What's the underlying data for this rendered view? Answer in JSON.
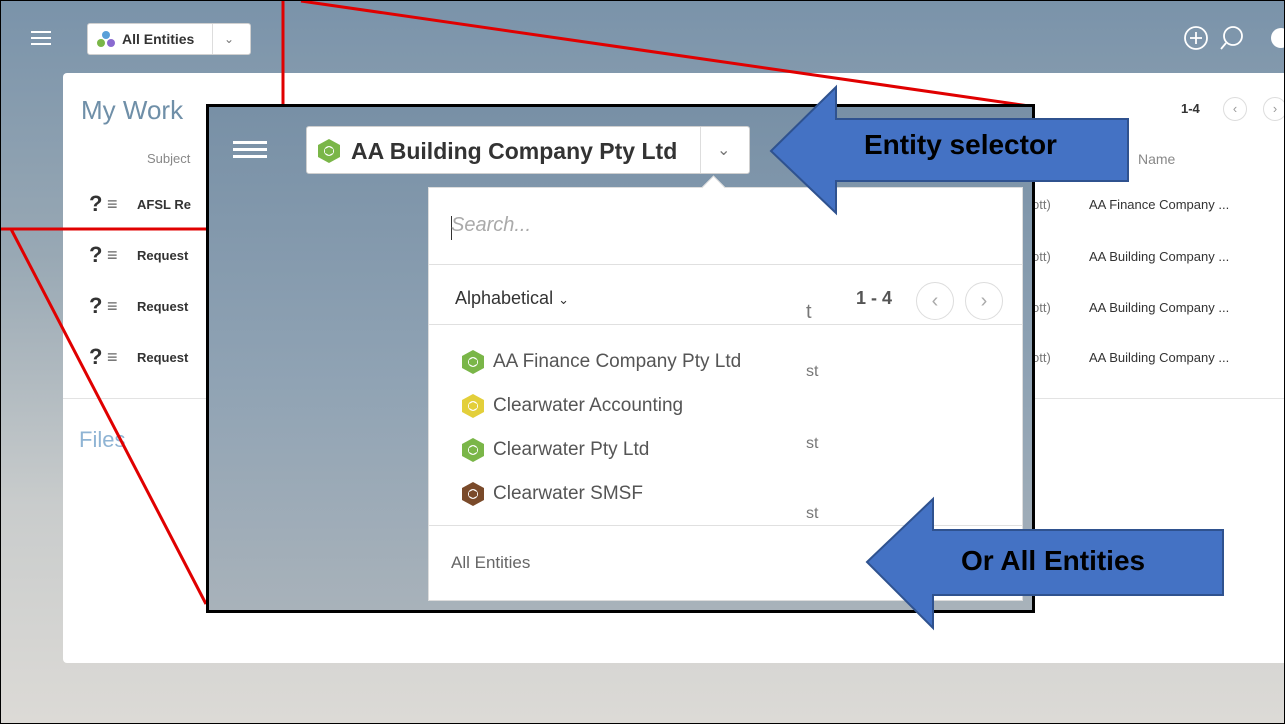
{
  "app": {
    "entity_selector_label": "All Entities",
    "my_work_title": "My Work",
    "subject_header": "Subject",
    "name_header": "Name",
    "pager": "1-4",
    "files_title": "Files",
    "rows": [
      {
        "subject": "AFSL Re",
        "suffix": "ott)",
        "name": "AA Finance Company ..."
      },
      {
        "subject": "Request",
        "suffix": "ott)",
        "name": "AA Building Company ..."
      },
      {
        "subject": "Request",
        "suffix": "ott)",
        "name": "AA Building Company ..."
      },
      {
        "subject": "Request",
        "suffix": "ott)",
        "name": "AA Building Company ..."
      }
    ]
  },
  "zoom": {
    "selected_entity": "AA Building Company Pty Ltd",
    "search_placeholder": "Search...",
    "sort_label": "Alphabetical",
    "pager": "1 - 4",
    "entities": [
      {
        "label": "AA Finance Company Pty Ltd",
        "color": "#7ab648"
      },
      {
        "label": "Clearwater Accounting",
        "color": "#e3cf3a"
      },
      {
        "label": "Clearwater Pty Ltd",
        "color": "#7ab648"
      },
      {
        "label": "Clearwater SMSF",
        "color": "#7a4a2a"
      }
    ],
    "all_entities": "All Entities",
    "partial_t": "t",
    "partial_st": "st"
  },
  "annotations": {
    "entity_selector": "Entity selector",
    "or_all_entities": "Or All Entities",
    "arrow_color": "#4472c4",
    "line_color": "#e00000"
  }
}
